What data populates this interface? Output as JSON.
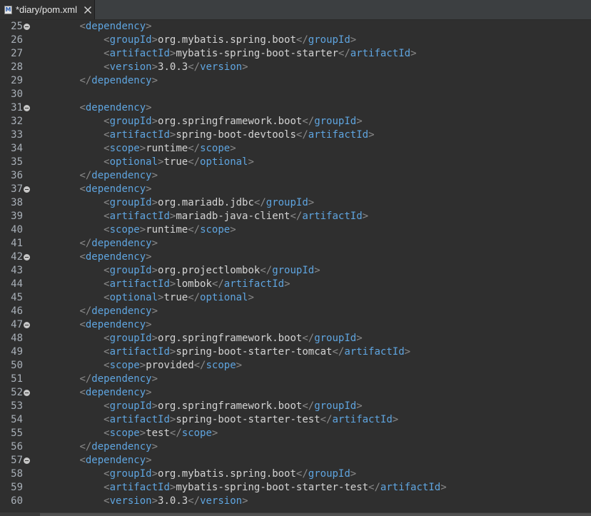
{
  "tab": {
    "icon_letter": "M",
    "title": "*diary/pom.xml"
  },
  "editor": {
    "lines": [
      {
        "num": "25",
        "fold": true,
        "indent": 2,
        "kind": "open",
        "tag": "dependency"
      },
      {
        "num": "26",
        "fold": false,
        "indent": 3,
        "kind": "elem",
        "tag": "groupId",
        "text": "org.mybatis.spring.boot"
      },
      {
        "num": "27",
        "fold": false,
        "indent": 3,
        "kind": "elem",
        "tag": "artifactId",
        "text": "mybatis-spring-boot-starter"
      },
      {
        "num": "28",
        "fold": false,
        "indent": 3,
        "kind": "elem",
        "tag": "version",
        "text": "3.0.3"
      },
      {
        "num": "29",
        "fold": false,
        "indent": 2,
        "kind": "close",
        "tag": "dependency"
      },
      {
        "num": "30",
        "fold": false,
        "indent": 0,
        "kind": "blank"
      },
      {
        "num": "31",
        "fold": true,
        "indent": 2,
        "kind": "open",
        "tag": "dependency"
      },
      {
        "num": "32",
        "fold": false,
        "indent": 3,
        "kind": "elem",
        "tag": "groupId",
        "text": "org.springframework.boot"
      },
      {
        "num": "33",
        "fold": false,
        "indent": 3,
        "kind": "elem",
        "tag": "artifactId",
        "text": "spring-boot-devtools"
      },
      {
        "num": "34",
        "fold": false,
        "indent": 3,
        "kind": "elem",
        "tag": "scope",
        "text": "runtime"
      },
      {
        "num": "35",
        "fold": false,
        "indent": 3,
        "kind": "elem",
        "tag": "optional",
        "text": "true"
      },
      {
        "num": "36",
        "fold": false,
        "indent": 2,
        "kind": "close",
        "tag": "dependency"
      },
      {
        "num": "37",
        "fold": true,
        "indent": 2,
        "kind": "open",
        "tag": "dependency"
      },
      {
        "num": "38",
        "fold": false,
        "indent": 3,
        "kind": "elem",
        "tag": "groupId",
        "text": "org.mariadb.jdbc"
      },
      {
        "num": "39",
        "fold": false,
        "indent": 3,
        "kind": "elem",
        "tag": "artifactId",
        "text": "mariadb-java-client"
      },
      {
        "num": "40",
        "fold": false,
        "indent": 3,
        "kind": "elem",
        "tag": "scope",
        "text": "runtime"
      },
      {
        "num": "41",
        "fold": false,
        "indent": 2,
        "kind": "close",
        "tag": "dependency"
      },
      {
        "num": "42",
        "fold": true,
        "indent": 2,
        "kind": "open",
        "tag": "dependency"
      },
      {
        "num": "43",
        "fold": false,
        "indent": 3,
        "kind": "elem",
        "tag": "groupId",
        "text": "org.projectlombok"
      },
      {
        "num": "44",
        "fold": false,
        "indent": 3,
        "kind": "elem",
        "tag": "artifactId",
        "text": "lombok"
      },
      {
        "num": "45",
        "fold": false,
        "indent": 3,
        "kind": "elem",
        "tag": "optional",
        "text": "true"
      },
      {
        "num": "46",
        "fold": false,
        "indent": 2,
        "kind": "close",
        "tag": "dependency"
      },
      {
        "num": "47",
        "fold": true,
        "indent": 2,
        "kind": "open",
        "tag": "dependency"
      },
      {
        "num": "48",
        "fold": false,
        "indent": 3,
        "kind": "elem",
        "tag": "groupId",
        "text": "org.springframework.boot"
      },
      {
        "num": "49",
        "fold": false,
        "indent": 3,
        "kind": "elem",
        "tag": "artifactId",
        "text": "spring-boot-starter-tomcat"
      },
      {
        "num": "50",
        "fold": false,
        "indent": 3,
        "kind": "elem",
        "tag": "scope",
        "text": "provided"
      },
      {
        "num": "51",
        "fold": false,
        "indent": 2,
        "kind": "close",
        "tag": "dependency"
      },
      {
        "num": "52",
        "fold": true,
        "indent": 2,
        "kind": "open",
        "tag": "dependency"
      },
      {
        "num": "53",
        "fold": false,
        "indent": 3,
        "kind": "elem",
        "tag": "groupId",
        "text": "org.springframework.boot"
      },
      {
        "num": "54",
        "fold": false,
        "indent": 3,
        "kind": "elem",
        "tag": "artifactId",
        "text": "spring-boot-starter-test"
      },
      {
        "num": "55",
        "fold": false,
        "indent": 3,
        "kind": "elem",
        "tag": "scope",
        "text": "test"
      },
      {
        "num": "56",
        "fold": false,
        "indent": 2,
        "kind": "close",
        "tag": "dependency"
      },
      {
        "num": "57",
        "fold": true,
        "indent": 2,
        "kind": "open",
        "tag": "dependency"
      },
      {
        "num": "58",
        "fold": false,
        "indent": 3,
        "kind": "elem",
        "tag": "groupId",
        "text": "org.mybatis.spring.boot"
      },
      {
        "num": "59",
        "fold": false,
        "indent": 3,
        "kind": "elem",
        "tag": "artifactId",
        "text": "mybatis-spring-boot-starter-test"
      },
      {
        "num": "60",
        "fold": false,
        "indent": 3,
        "kind": "elem",
        "tag": "version",
        "text": "3.0.3"
      }
    ]
  },
  "colors": {
    "tag": "#5fa5e0",
    "bracket": "#8b8b8b",
    "text": "#d4d4d4",
    "line_number": "#a9b0b8",
    "background": "#2f2f2f"
  }
}
